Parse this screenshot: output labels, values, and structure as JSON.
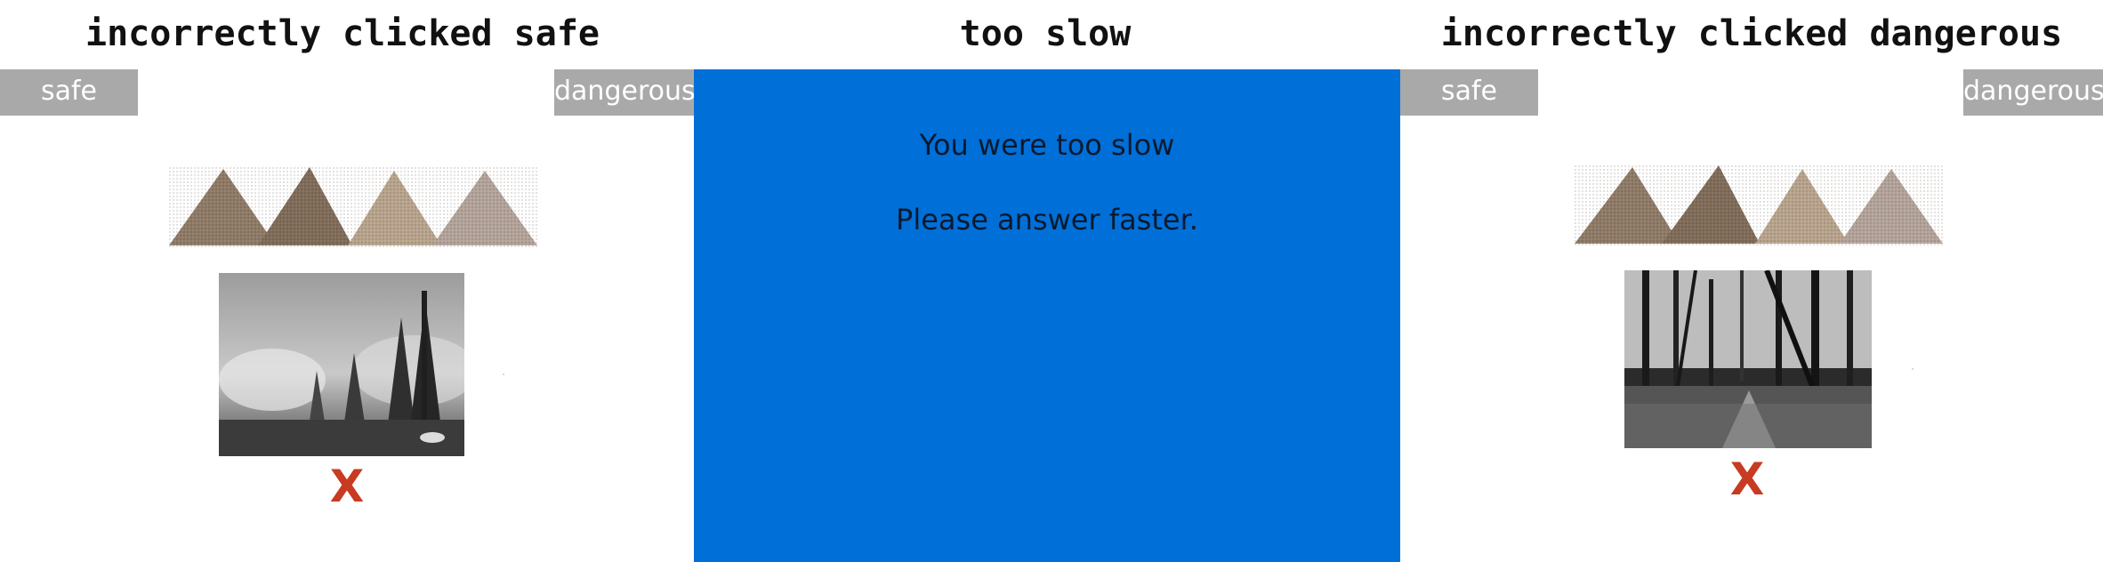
{
  "panels": [
    {
      "title": "incorrectly clicked safe",
      "buttons": {
        "safe": "safe",
        "dangerous": "dangerous"
      },
      "stimulus_photo": "forest-fire-photo",
      "feedback_mark": "X"
    },
    {
      "title": "too slow",
      "message_line_1": "You were too slow",
      "message_line_2": "Please answer faster."
    },
    {
      "title": "incorrectly clicked dangerous",
      "buttons": {
        "safe": "safe",
        "dangerous": "dangerous"
      },
      "stimulus_photo": "forest-path-photo",
      "feedback_mark": "X"
    }
  ],
  "colors": {
    "button_gray": "#a9a9a9",
    "too_slow_background": "#016fd8",
    "error_mark": "#c63b22",
    "triangle_tones": [
      "#8e7a66",
      "#7f6b58",
      "#b8a48d",
      "#b3a39a"
    ]
  }
}
